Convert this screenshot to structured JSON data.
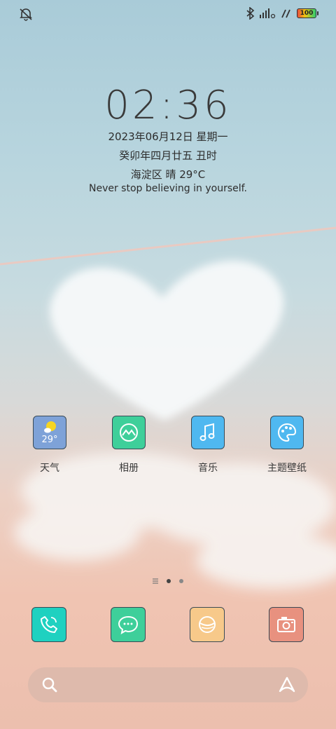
{
  "status": {
    "battery": "100",
    "icons": [
      "mute-vibrate-icon",
      "bluetooth-icon",
      "signal-icon",
      "data-icon",
      "battery-icon"
    ]
  },
  "lockinfo": {
    "time": "02:36",
    "date": "2023年06月12日  星期一",
    "lunar": "癸卯年四月廿五  丑时",
    "weather": "海淀区   晴   29°C",
    "motto": "Never stop believing in yourself."
  },
  "apps": [
    {
      "label": "天气",
      "icon": "weather-icon",
      "badge": "29°",
      "color": "#7ea2d8"
    },
    {
      "label": "相册",
      "icon": "gallery-icon",
      "color": "#3ecf9a"
    },
    {
      "label": "音乐",
      "icon": "music-icon",
      "color": "#4fb8f0"
    },
    {
      "label": "主题壁纸",
      "icon": "palette-icon",
      "color": "#4fb8f0"
    }
  ],
  "dock": [
    {
      "icon": "phone-icon",
      "color": "#1fd1c0"
    },
    {
      "icon": "messages-icon",
      "color": "#3ecf9a"
    },
    {
      "icon": "browser-icon",
      "color": "#f7c98a"
    },
    {
      "icon": "camera-icon",
      "color": "#e8917f"
    }
  ],
  "colors": {
    "text": "#2d2d2d",
    "tile_border": "#3a4a55"
  }
}
